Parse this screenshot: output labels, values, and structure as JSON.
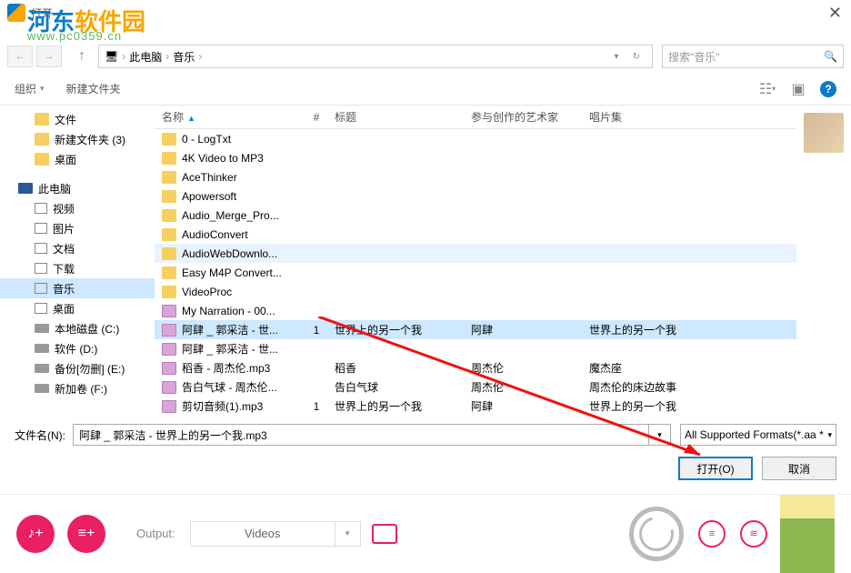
{
  "dialog": {
    "title": "打开",
    "watermark_main": "河东",
    "watermark_sub": "软件园",
    "watermark_url": "www.pc0359.cn"
  },
  "breadcrumb": {
    "pc": "此电脑",
    "folder": "音乐"
  },
  "search": {
    "placeholder": "搜索\"音乐\""
  },
  "toolbar": {
    "organize": "组织",
    "new_folder": "新建文件夹"
  },
  "sidebar": {
    "items": [
      {
        "label": "文件",
        "type": "folder",
        "lvl": 2
      },
      {
        "label": "新建文件夹 (3)",
        "type": "folder",
        "lvl": 2
      },
      {
        "label": "桌面",
        "type": "folder",
        "lvl": 2
      },
      {
        "label": "",
        "type": "spacer"
      },
      {
        "label": "此电脑",
        "type": "pc",
        "lvl": 1
      },
      {
        "label": "视频",
        "type": "media",
        "lvl": 2
      },
      {
        "label": "图片",
        "type": "media",
        "lvl": 2
      },
      {
        "label": "文档",
        "type": "media",
        "lvl": 2
      },
      {
        "label": "下载",
        "type": "media",
        "lvl": 2
      },
      {
        "label": "音乐",
        "type": "media",
        "lvl": 2,
        "selected": true
      },
      {
        "label": "桌面",
        "type": "media",
        "lvl": 2
      },
      {
        "label": "本地磁盘 (C:)",
        "type": "drive",
        "lvl": 2
      },
      {
        "label": "软件 (D:)",
        "type": "drive",
        "lvl": 2
      },
      {
        "label": "备份[勿删] (E:)",
        "type": "drive",
        "lvl": 2
      },
      {
        "label": "新加卷 (F:)",
        "type": "drive",
        "lvl": 2
      }
    ]
  },
  "columns": {
    "name": "名称",
    "num": "#",
    "title": "标题",
    "artist": "参与创作的艺术家",
    "album": "唱片集"
  },
  "files": [
    {
      "name": "0 - LogTxt",
      "type": "folder"
    },
    {
      "name": "4K Video to MP3",
      "type": "folder"
    },
    {
      "name": "AceThinker",
      "type": "folder"
    },
    {
      "name": "Apowersoft",
      "type": "folder"
    },
    {
      "name": "Audio_Merge_Pro...",
      "type": "folder"
    },
    {
      "name": "AudioConvert",
      "type": "folder"
    },
    {
      "name": "AudioWebDownlo...",
      "type": "folder",
      "highlighted": true
    },
    {
      "name": "Easy M4P Convert...",
      "type": "folder"
    },
    {
      "name": "VideoProc",
      "type": "folder"
    },
    {
      "name": "My Narration - 00...",
      "type": "audio"
    },
    {
      "name": "阿肆 _ 郭采洁 - 世...",
      "type": "audio",
      "num": "1",
      "title": "世界上的另一个我",
      "artist": "阿肆",
      "album": "世界上的另一个我",
      "selected": true
    },
    {
      "name": "阿肆 _ 郭采洁 - 世...",
      "type": "audio"
    },
    {
      "name": "稻香 - 周杰伦.mp3",
      "type": "audio",
      "title": "稻香",
      "artist": "周杰伦",
      "album": "魔杰座"
    },
    {
      "name": "告白气球 - 周杰伦...",
      "type": "audio",
      "title": "告白气球",
      "artist": "周杰伦",
      "album": "周杰伦的床边故事"
    },
    {
      "name": "剪切音频(1).mp3",
      "type": "audio",
      "num": "1",
      "title": "世界上的另一个我",
      "artist": "阿肆",
      "album": "世界上的另一个我"
    }
  ],
  "filename": {
    "label": "文件名(N):",
    "value": "阿肆 _ 郭采洁 - 世界上的另一个我.mp3",
    "format": "All Supported Formats(*.aa *"
  },
  "buttons": {
    "open": "打开(O)",
    "cancel": "取消"
  },
  "footer": {
    "output_label": "Output:",
    "output_value": "Videos"
  }
}
